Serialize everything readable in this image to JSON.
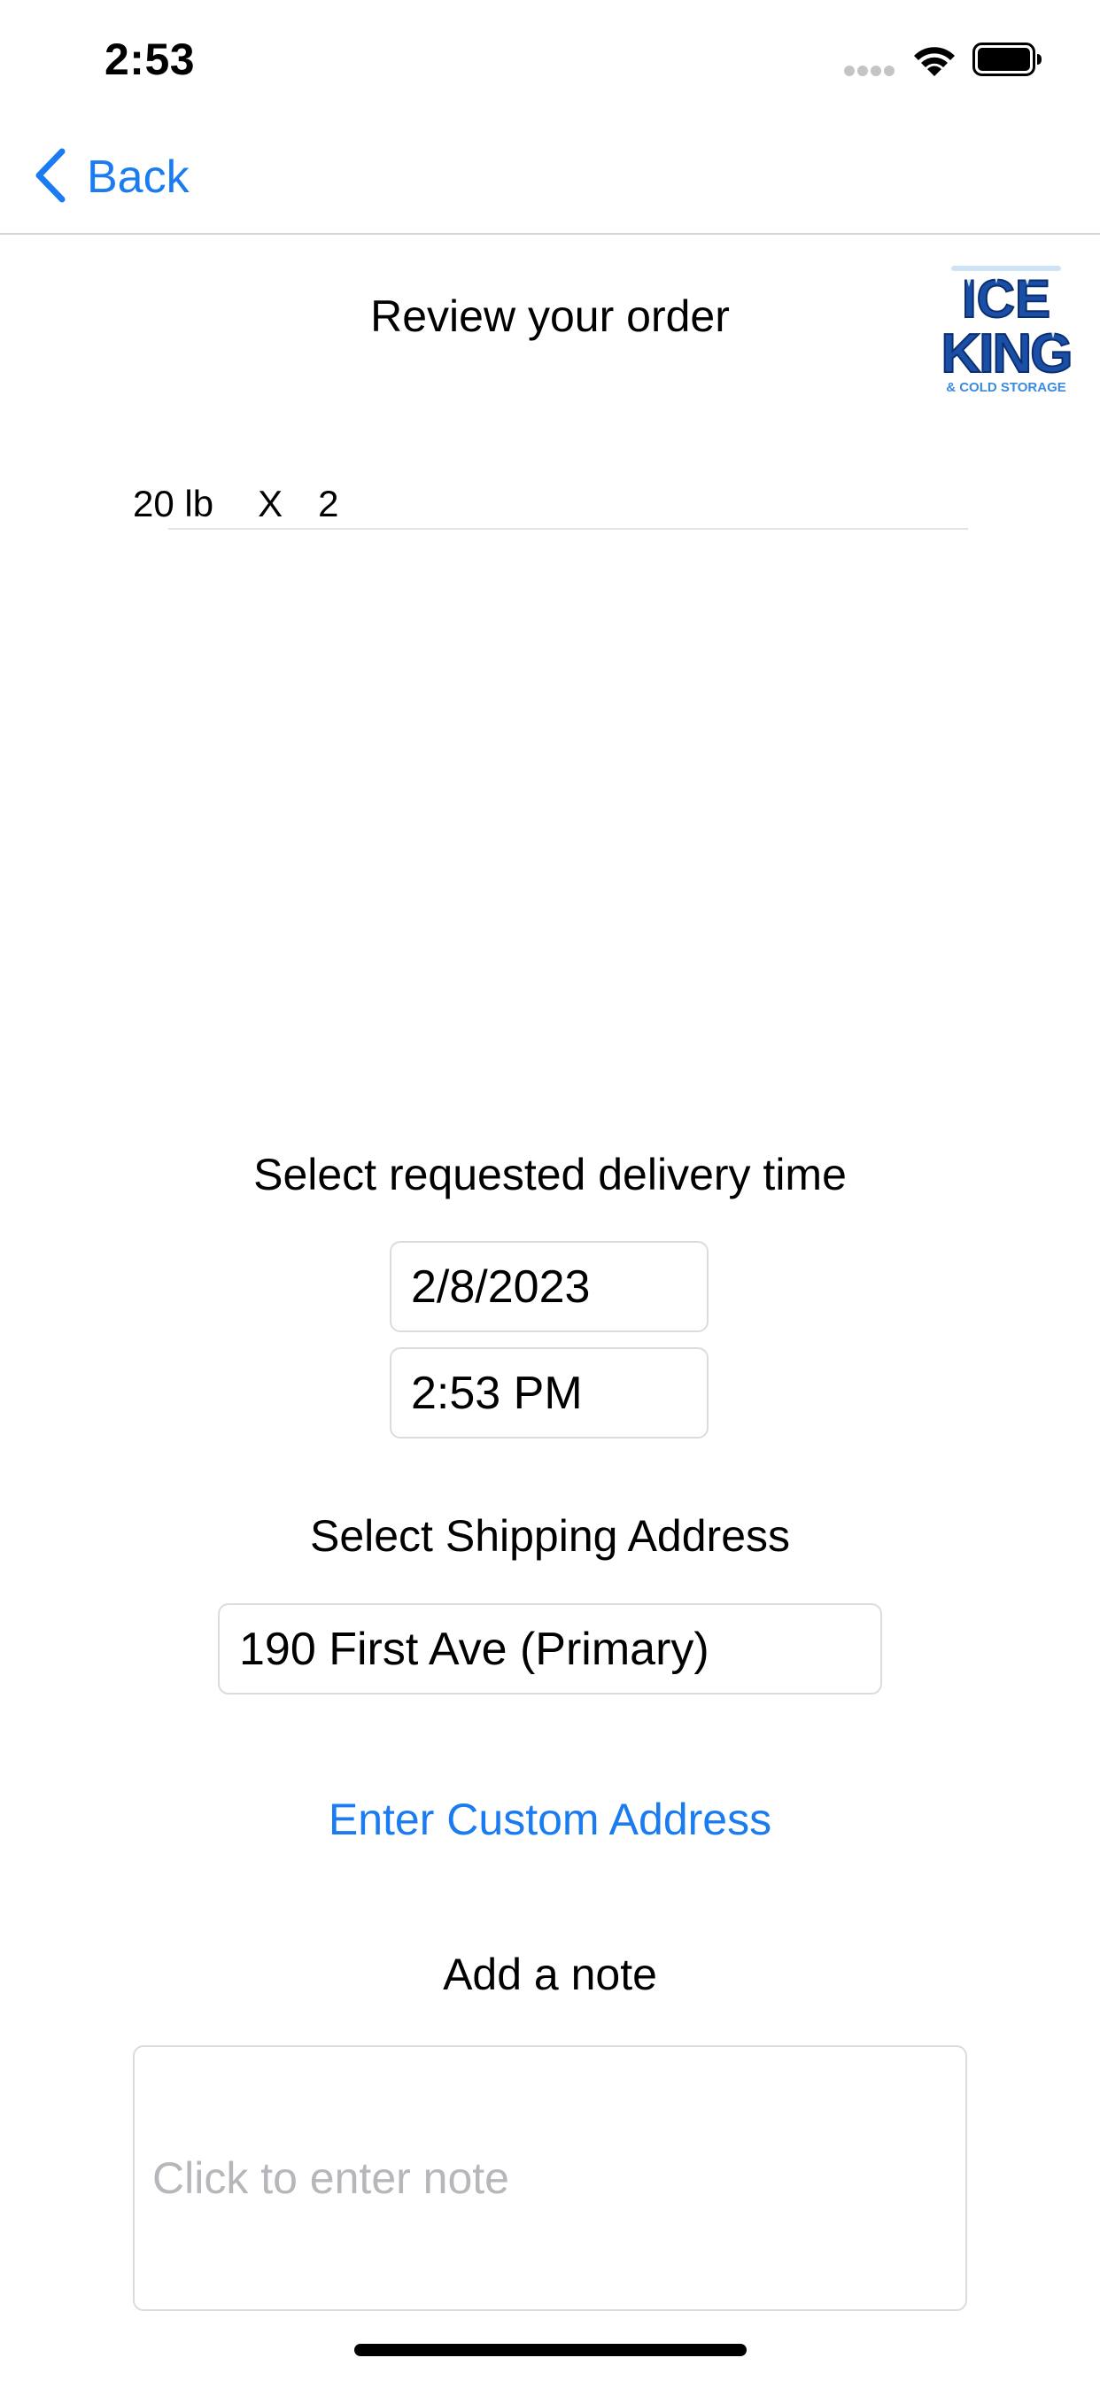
{
  "colors": {
    "accent": "#1a7cf0",
    "logo_blue": "#1a4fa8",
    "logo_light": "#3a8be0"
  },
  "status_bar": {
    "time": "2:53",
    "icons": [
      "signal-icon",
      "wifi-icon",
      "battery-icon"
    ]
  },
  "nav": {
    "back_label": "Back",
    "back_icon": "chevron-left-icon"
  },
  "header": {
    "title": "Review your order",
    "logo": {
      "line1": "ICE",
      "line2": "KING",
      "tagline": "& COLD STORAGE"
    }
  },
  "order": {
    "items": [
      {
        "size": "20 lb",
        "separator": "X",
        "quantity": "2"
      }
    ]
  },
  "delivery": {
    "label": "Select requested delivery time",
    "date": "2/8/2023",
    "time": "2:53 PM"
  },
  "shipping": {
    "label": "Select Shipping Address",
    "selected_address": "190 First Ave (Primary)",
    "custom_address_link": "Enter Custom Address"
  },
  "note": {
    "label": "Add a note",
    "placeholder": "Click to enter note"
  }
}
